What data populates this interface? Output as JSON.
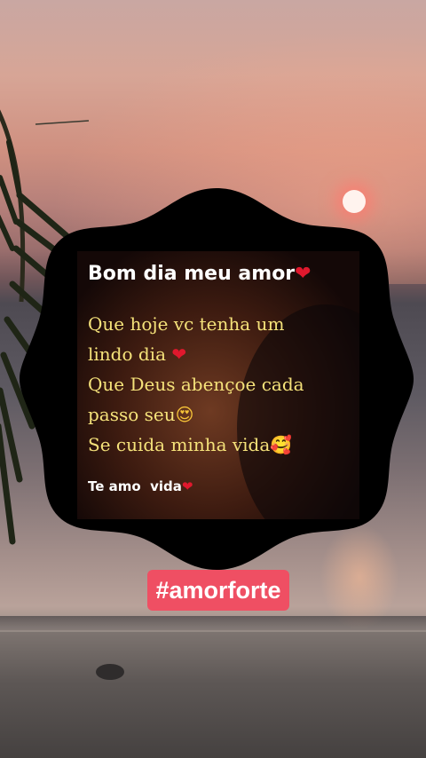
{
  "card": {
    "title": "Bom dia meu amor",
    "title_emoji": "❤",
    "lines": [
      {
        "text": "Que hoje vc tenha um",
        "emoji": ""
      },
      {
        "text": "lindo dia ",
        "emoji": "❤"
      },
      {
        "text": "Que Deus abençoe cada",
        "emoji": ""
      },
      {
        "text": "passo seu",
        "emoji": "😍"
      },
      {
        "text": "Se cuida minha vida",
        "emoji": "🥰"
      }
    ],
    "signature": "Te amo  vida",
    "signature_emoji": "❤"
  },
  "hashtag": "#amorforte",
  "colors": {
    "badge": "#000000",
    "title_text": "#ffffff",
    "message_text": "#f5e27a",
    "heart": "#e0182d",
    "hashtag_background": "#ef4f63",
    "hashtag_text": "#ffffff",
    "sun": "#fff3ee"
  }
}
